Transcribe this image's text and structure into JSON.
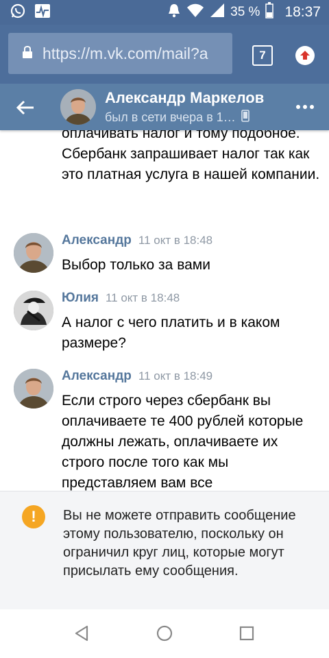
{
  "status_bar": {
    "battery": "35 %",
    "time": "18:37",
    "icons": [
      "whatsapp-icon",
      "activity-icon",
      "bell-icon",
      "wifi-icon",
      "signal-icon",
      "battery-icon"
    ]
  },
  "browser": {
    "url": "https://m.vk.com/mail?a",
    "tab_count": "7"
  },
  "header": {
    "name": "Александр Маркелов",
    "status": "был в сети вчера в 1…"
  },
  "messages": {
    "continuation": "оплачивать налог и тому подобное. Сбербанк запрашивает налог так как это платная услуга в нашей компании.",
    "items": [
      {
        "author": "Александр",
        "time": "11 окт в 18:48",
        "text": "Выбор только за вами"
      },
      {
        "author": "Юлия",
        "time": "11 окт в 18:48",
        "text": "А налог с чего платить и в каком размере?"
      },
      {
        "author": "Александр",
        "time": "11 окт в 18:49",
        "text": "Если строго через сбербанк вы оплачиваете те 400 рублей которые должны лежать, оплачиваете их строго после того как мы представляем вам все"
      }
    ]
  },
  "notice": {
    "icon": "!",
    "text": "Вы не можете отправить сообщение этому пользователю, поскольку он ограничил круг лиц, которые могут присылать ему сообщения."
  },
  "colors": {
    "header_bg": "#5b7fa6",
    "author": "#55779c",
    "notice_icon": "#f5a623"
  }
}
